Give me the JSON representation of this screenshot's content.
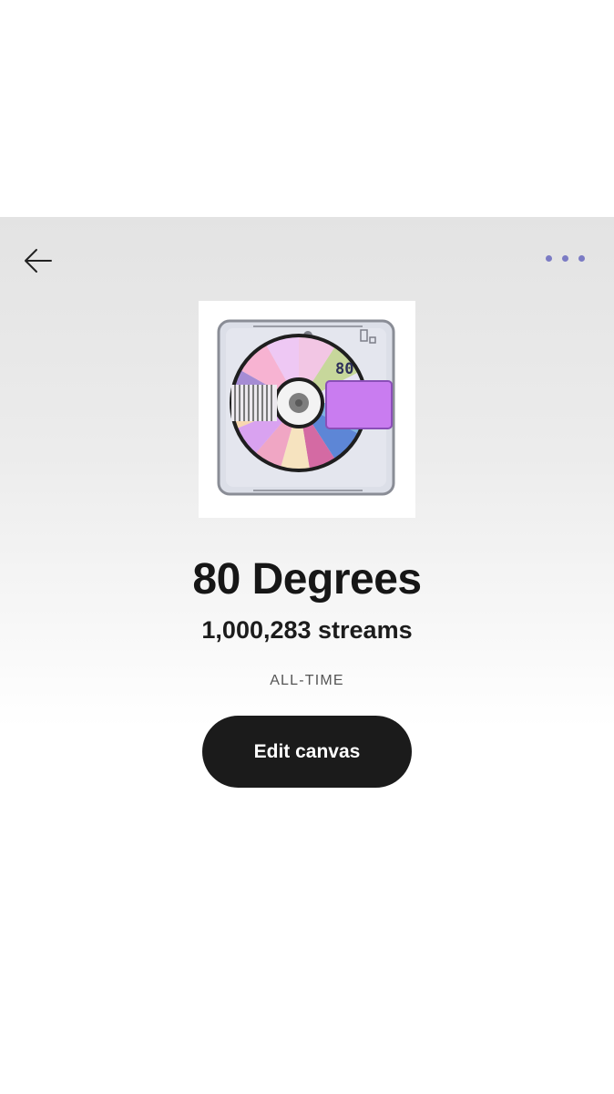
{
  "header": {
    "back_icon": "arrow-left-icon",
    "more_icon": "more-horizontal-icon"
  },
  "artwork": {
    "label": "80"
  },
  "track": {
    "title": "80 Degrees",
    "streams": "1,000,283 streams",
    "period": "ALL-TIME"
  },
  "actions": {
    "edit_canvas_label": "Edit canvas"
  },
  "colors": {
    "more_dots": "#7b7bc4",
    "button_bg": "#1b1b1b",
    "button_text": "#ffffff"
  }
}
